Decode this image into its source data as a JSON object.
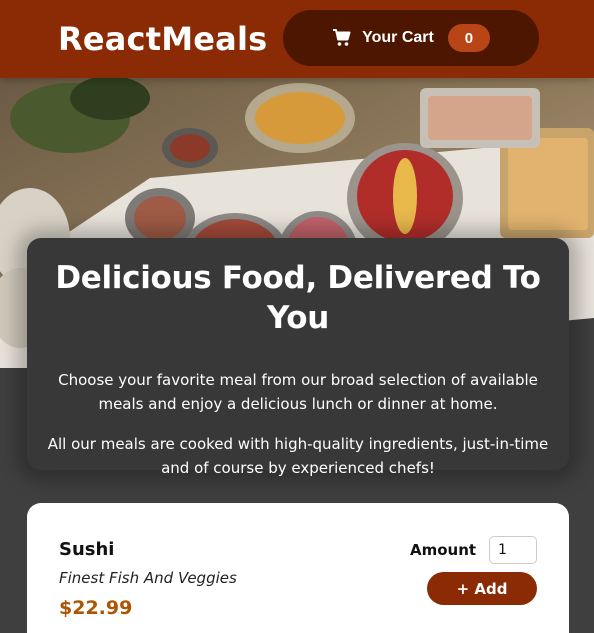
{
  "header": {
    "brand": "ReactMeals",
    "cart_label": "Your Cart",
    "cart_count": "0",
    "cart_icon": "cart-icon"
  },
  "summary": {
    "title": "Delicious Food, Delivered To You",
    "paragraph_1": "Choose your favorite meal from our broad selection of available meals and enjoy a delicious lunch or dinner at home.",
    "paragraph_2": "All our meals are cooked with high-quality ingredients, just-in-time and of course by experienced chefs!"
  },
  "meals": [
    {
      "name": "Sushi",
      "description": "Finest Fish And Veggies",
      "price": "$22.99",
      "amount_label": "Amount",
      "amount_value": "1",
      "add_label": "+ Add"
    }
  ],
  "colors": {
    "header_bg": "#8a2b06",
    "cart_button_bg": "#4d1601",
    "badge_bg": "#b94517",
    "price": "#ad5502",
    "page_bg": "#3f3f3f"
  }
}
